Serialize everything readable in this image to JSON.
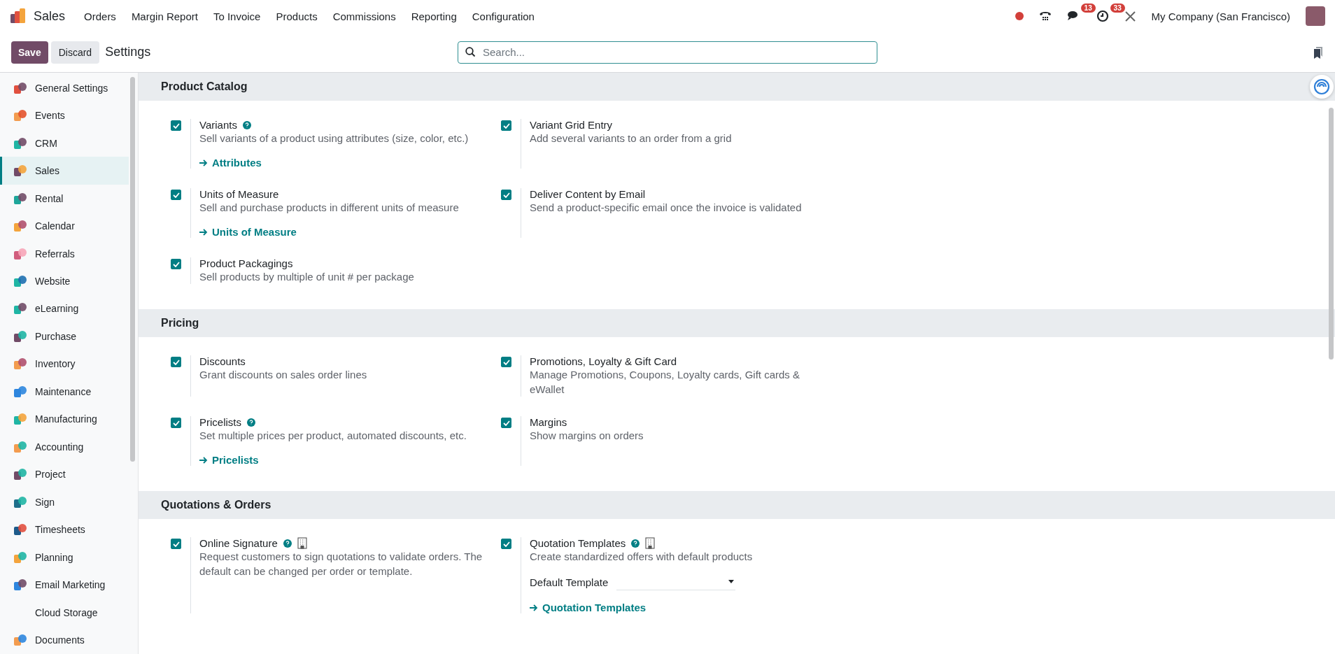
{
  "navbar": {
    "app": "Sales",
    "menu": [
      "Orders",
      "Margin Report",
      "To Invoice",
      "Products",
      "Commissions",
      "Reporting",
      "Configuration"
    ],
    "messages_count": "13",
    "activities_count": "33",
    "company": "My Company (San Francisco)"
  },
  "control_panel": {
    "save": "Save",
    "discard": "Discard",
    "title": "Settings",
    "search": {
      "placeholder": "Search..."
    }
  },
  "sidebar": {
    "items": [
      {
        "label": "General Settings",
        "selected": false
      },
      {
        "label": "Events",
        "selected": false
      },
      {
        "label": "CRM",
        "selected": false
      },
      {
        "label": "Sales",
        "selected": true
      },
      {
        "label": "Rental",
        "selected": false
      },
      {
        "label": "Calendar",
        "selected": false
      },
      {
        "label": "Referrals",
        "selected": false
      },
      {
        "label": "Website",
        "selected": false
      },
      {
        "label": "eLearning",
        "selected": false
      },
      {
        "label": "Purchase",
        "selected": false
      },
      {
        "label": "Inventory",
        "selected": false
      },
      {
        "label": "Maintenance",
        "selected": false
      },
      {
        "label": "Manufacturing",
        "selected": false
      },
      {
        "label": "Accounting",
        "selected": false
      },
      {
        "label": "Project",
        "selected": false
      },
      {
        "label": "Sign",
        "selected": false
      },
      {
        "label": "Timesheets",
        "selected": false
      },
      {
        "label": "Planning",
        "selected": false
      },
      {
        "label": "Email Marketing",
        "selected": false
      },
      {
        "label": "Cloud Storage",
        "selected": false
      },
      {
        "label": "Documents",
        "selected": false
      }
    ]
  },
  "sections": [
    {
      "title": "Product Catalog",
      "settings": [
        {
          "title": "Variants",
          "checked": true,
          "help": true,
          "company": false,
          "description": "Sell variants of a product using attributes (size, color, etc.)",
          "link": "Attributes"
        },
        {
          "title": "Variant Grid Entry",
          "checked": true,
          "help": false,
          "company": false,
          "description": "Add several variants to an order from a grid"
        },
        {
          "title": "Units of Measure",
          "checked": true,
          "help": false,
          "company": false,
          "description": "Sell and purchase products in different units of measure",
          "link": "Units of Measure"
        },
        {
          "title": "Deliver Content by Email",
          "checked": true,
          "help": false,
          "company": false,
          "description": "Send a product-specific email once the invoice is validated"
        },
        {
          "title": "Product Packagings",
          "checked": true,
          "help": false,
          "company": false,
          "description": "Sell products by multiple of unit # per package"
        }
      ]
    },
    {
      "title": "Pricing",
      "settings": [
        {
          "title": "Discounts",
          "checked": true,
          "help": false,
          "company": false,
          "description": "Grant discounts on sales order lines"
        },
        {
          "title": "Promotions, Loyalty & Gift Card",
          "checked": true,
          "help": false,
          "company": false,
          "description": "Manage Promotions, Coupons, Loyalty cards, Gift cards & eWallet"
        },
        {
          "title": "Pricelists",
          "checked": true,
          "help": true,
          "company": false,
          "description": "Set multiple prices per product, automated discounts, etc.",
          "link": "Pricelists"
        },
        {
          "title": "Margins",
          "checked": true,
          "help": false,
          "company": false,
          "description": "Show margins on orders"
        }
      ]
    },
    {
      "title": "Quotations & Orders",
      "settings": [
        {
          "title": "Online Signature",
          "checked": true,
          "help": true,
          "company": true,
          "description": "Request customers to sign quotations to validate orders. The default can be changed per order or template."
        },
        {
          "title": "Quotation Templates",
          "checked": true,
          "help": true,
          "company": true,
          "description": "Create standardized offers with default products",
          "field_label": "Default Template",
          "link": "Quotation Templates"
        }
      ]
    }
  ]
}
